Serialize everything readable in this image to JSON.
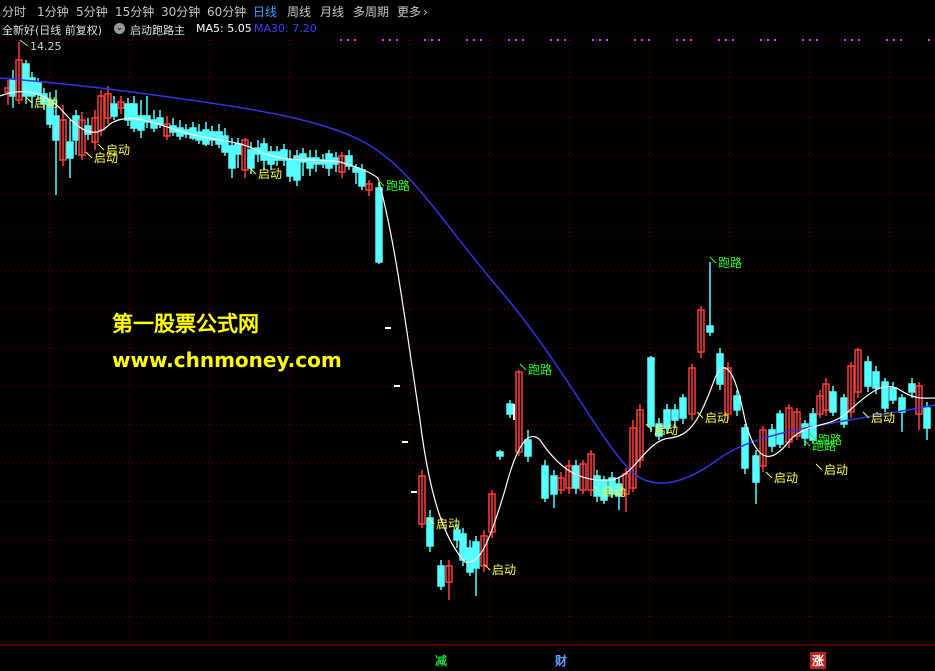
{
  "tabs": [
    "分时",
    "1分钟",
    "5分钟",
    "15分钟",
    "30分钟",
    "60分钟",
    "日线",
    "周线",
    "月线",
    "多周期",
    "更多"
  ],
  "active_tab": "日线",
  "info": {
    "stock_name": "全新好(日线 前复权)",
    "indicator": "启动跑路主",
    "ma5": "MA5: 5.05",
    "ma30": "MA30: 7.20"
  },
  "price_label": "14.25",
  "watermark": {
    "title": "第一股票公式网",
    "url": "www.chnmoney.com"
  },
  "signal_labels": {
    "start": "启动",
    "run": "跑路"
  },
  "bottom_marks": [
    "减",
    "财",
    "涨"
  ],
  "colors": {
    "up": "#ff3c3c",
    "down": "#54ffff",
    "ma5": "#ffffff",
    "ma30": "#3434e0",
    "grid": "#7a0000",
    "label": "#ffff40",
    "run_label": "#20ff20",
    "dots": "#d040ff"
  },
  "icons": {
    "info_toggle": "circle-chevron-down-icon",
    "more": "chevron-right-icon"
  }
}
